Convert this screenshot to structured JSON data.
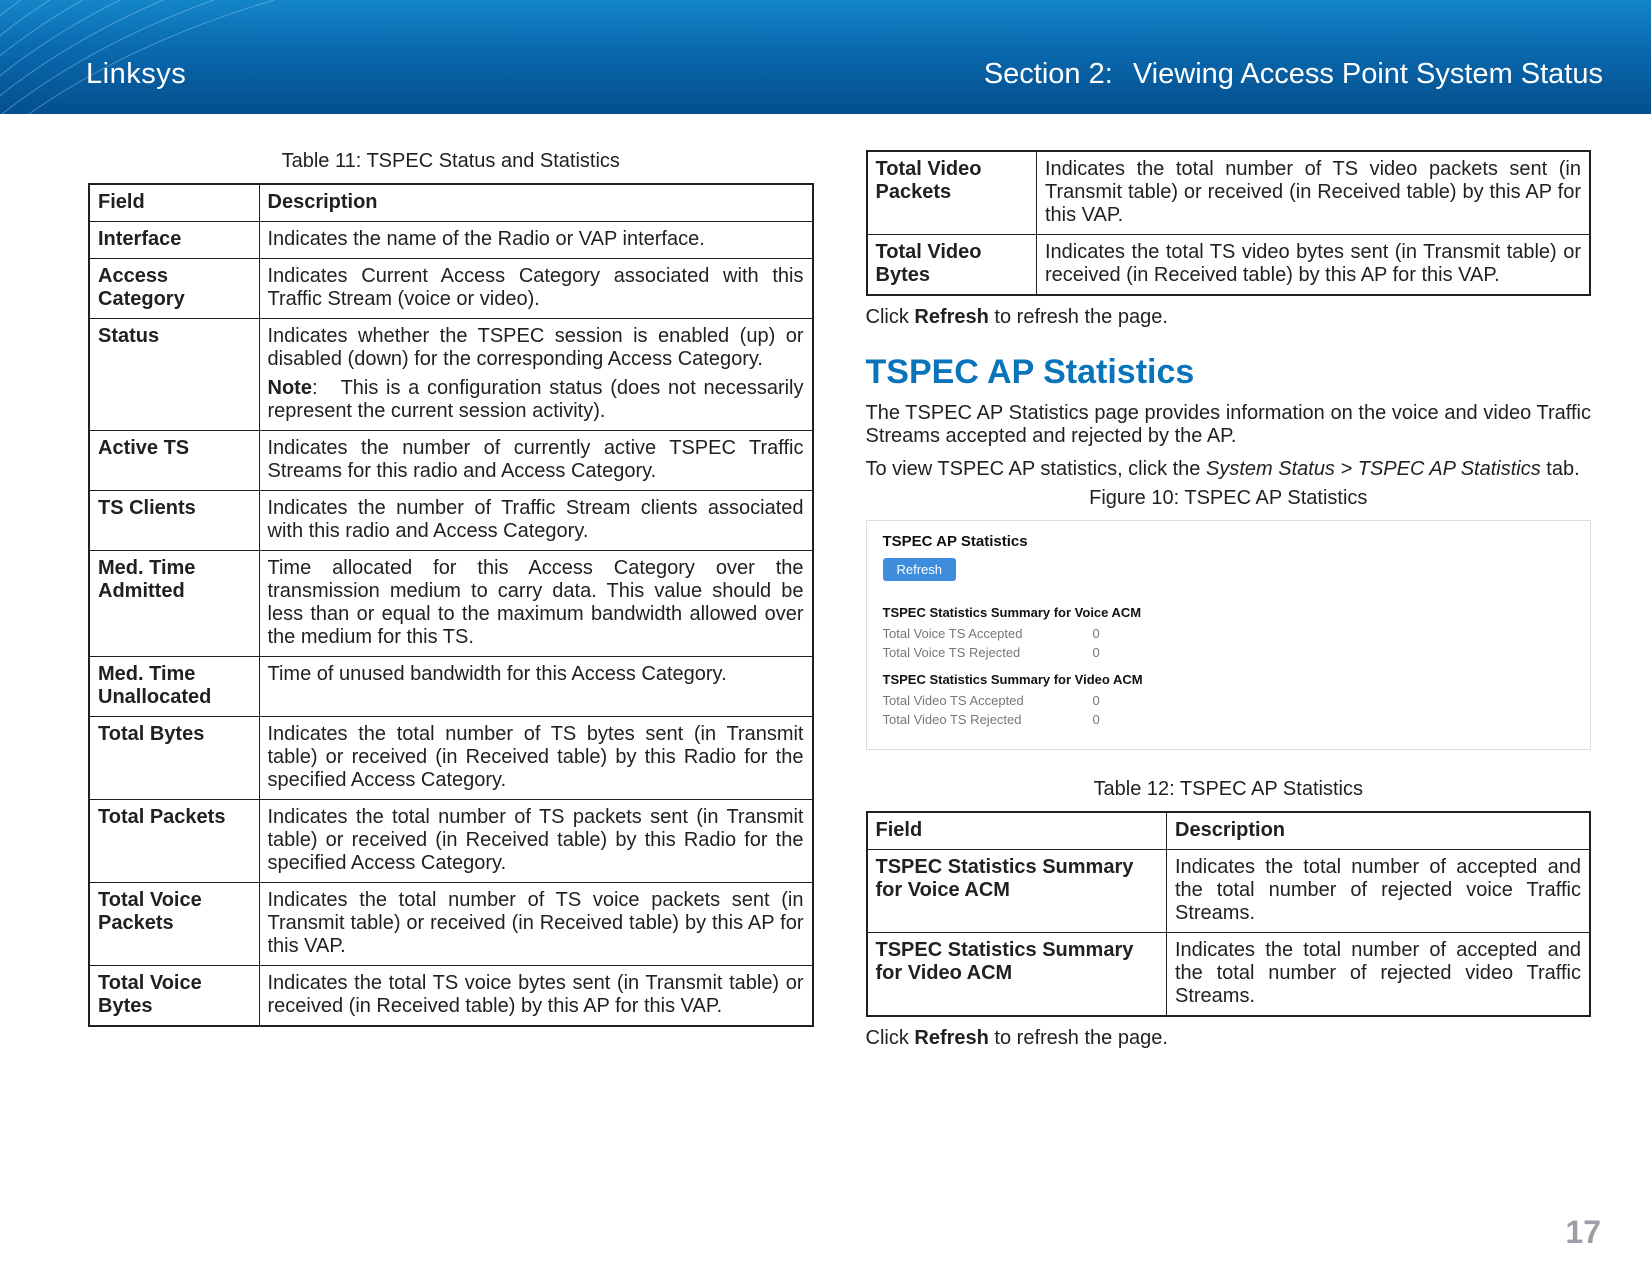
{
  "header": {
    "brand": "Linksys",
    "section_label": "Section 2:",
    "section_text": "Viewing Access Point System Status"
  },
  "table11": {
    "caption": "Table 11: TSPEC Status and Statistics",
    "head_field": "Field",
    "head_desc": "Description",
    "rows": [
      {
        "field": "Interface",
        "desc": "Indicates the name of the Radio or VAP interface."
      },
      {
        "field": "Access Category",
        "desc": "Indicates Current Access Category associated with this Traffic Stream (voice or video)."
      },
      {
        "field": "Status",
        "desc": "Indicates whether the TSPEC session is enabled (up) or disabled (down) for the corresponding Access Category.",
        "note_label": "Note",
        "note_text": "This is a configuration status (does not necessarily represent the current session activity)."
      },
      {
        "field": "Active TS",
        "desc": "Indicates the number of currently active TSPEC Traffic Streams for this radio and Access Category."
      },
      {
        "field": "TS Clients",
        "desc": "Indicates the number of Traffic Stream clients associated with this radio and Access Category."
      },
      {
        "field": "Med. Time Admitted",
        "desc": "Time allocated for this Access Category over the transmission medium to carry data. This value should be less than or equal to the maximum bandwidth allowed over the medium for this TS."
      },
      {
        "field": "Med. Time Unallocated",
        "desc": "Time of unused bandwidth for this Access Category."
      },
      {
        "field": "Total Bytes",
        "desc": "Indicates the total number of TS bytes sent (in Transmit table) or received (in Received table) by this Radio for the specified Access Category."
      },
      {
        "field": "Total Packets",
        "desc": "Indicates the total number of TS packets sent (in Transmit table) or received (in Received table) by this Radio for the specified Access Category."
      },
      {
        "field": "Total Voice Packets",
        "desc": "Indicates the total number of TS voice packets sent (in Transmit table) or received (in Received table) by this AP for this VAP."
      },
      {
        "field": "Total Voice Bytes",
        "desc": "Indicates the total TS voice bytes sent (in Transmit table) or received (in Received table) by this AP for this VAP."
      }
    ]
  },
  "table11_cont": {
    "rows": [
      {
        "field": "Total Video Packets",
        "desc": "Indicates the total number of TS video packets sent (in Transmit table) or received (in Received table) by this AP for this VAP."
      },
      {
        "field": "Total Video Bytes",
        "desc": "Indicates the total TS video bytes sent (in Transmit table) or received (in Received table) by this AP for this VAP."
      }
    ]
  },
  "refresh_line": {
    "pre": "Click ",
    "bold": "Refresh",
    "post": " to refresh the page."
  },
  "h2": "TSPEC AP Statistics",
  "intro_p1": "The TSPEC AP Statistics page provides information on the voice and video Traffic Streams accepted and rejected by the AP.",
  "intro_p2_pre": "To view TSPEC AP statistics, click the ",
  "intro_p2_italic": "System Status > TSPEC AP Statistics",
  "intro_p2_post": " tab.",
  "fig10_caption": "Figure 10: TSPEC AP Statistics",
  "shot": {
    "title": "TSPEC AP Statistics",
    "btn": "Refresh",
    "sub1": "TSPEC Statistics Summary for Voice ACM",
    "r1k": "Total Voice TS Accepted",
    "r1v": "0",
    "r2k": "Total Voice TS Rejected",
    "r2v": "0",
    "sub2": "TSPEC Statistics Summary for Video ACM",
    "r3k": "Total Video TS Accepted",
    "r3v": "0",
    "r4k": "Total Video TS Rejected",
    "r4v": "0"
  },
  "table12": {
    "caption": "Table 12: TSPEC AP Statistics",
    "head_field": "Field",
    "head_desc": "Description",
    "rows": [
      {
        "field": "TSPEC Statistics Summary for Voice ACM",
        "desc": "Indicates the total number of accepted and the total number of rejected voice Traffic Streams."
      },
      {
        "field": "TSPEC Statistics Summary for Video ACM",
        "desc": "Indicates the total number of accepted and the total number of rejected video Traffic Streams."
      }
    ]
  },
  "page_number": "17"
}
